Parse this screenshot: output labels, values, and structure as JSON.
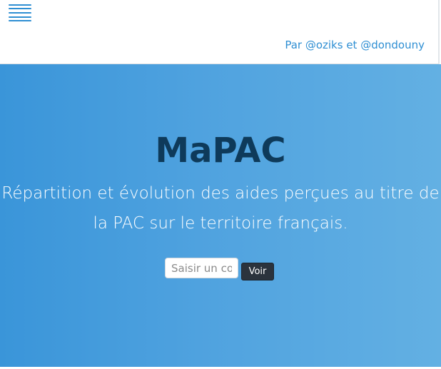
{
  "header": {
    "menu_icon": "hamburger-menu-icon",
    "credits": "Par @oziks et @dondouny",
    "accent_color": "#2f8fd3"
  },
  "hero": {
    "title": "MaPAC",
    "subtitle_line1": "Répartition et évolution des aides perçues au titre de",
    "subtitle_line2": "la PAC sur le territoire français.",
    "gradient_start": "#3a95d9",
    "gradient_end": "#63b0e3",
    "title_color": "#0e3a5a"
  },
  "search": {
    "placeholder": "Saisir un code postal",
    "value": "",
    "button_label": "Voir"
  }
}
